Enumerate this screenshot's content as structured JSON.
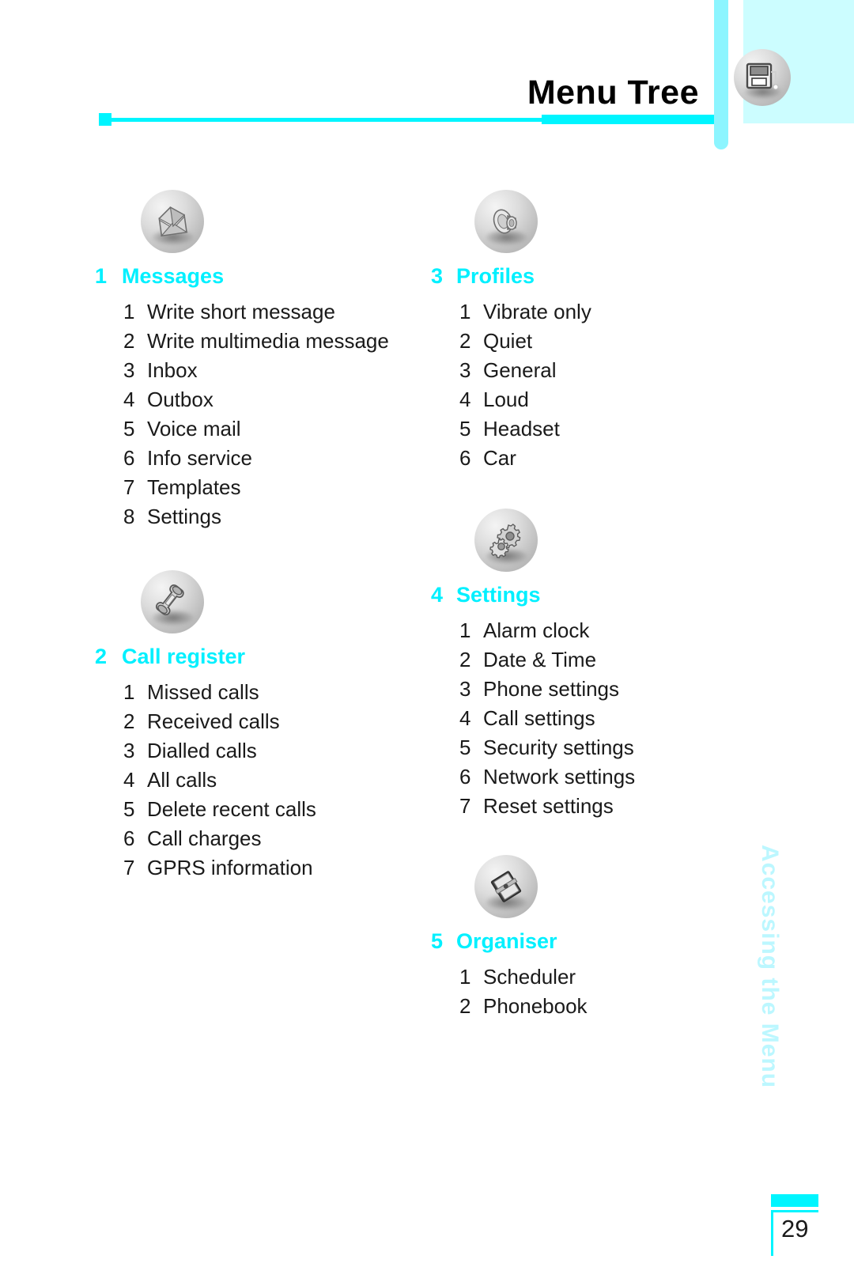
{
  "header": {
    "title": "Menu Tree",
    "icon": "floppy-disk-icon"
  },
  "side_tab": {
    "label": "Accessing the Menu"
  },
  "footer": {
    "page_number": "29"
  },
  "colors": {
    "accent_cyan": "#00f5ff",
    "heading_cyan": "#00f0ff",
    "panel_light_cyan": "#ccfdff",
    "side_tab_cyan": "#bcf7ff",
    "text_black": "#1a1a1a"
  },
  "columns": {
    "left": [
      {
        "number": "1",
        "title": "Messages",
        "icon": "envelope-icon",
        "items": [
          {
            "number": "1",
            "label": "Write short message"
          },
          {
            "number": "2",
            "label": "Write multimedia message"
          },
          {
            "number": "3",
            "label": "Inbox"
          },
          {
            "number": "4",
            "label": "Outbox"
          },
          {
            "number": "5",
            "label": "Voice mail"
          },
          {
            "number": "6",
            "label": "Info service"
          },
          {
            "number": "7",
            "label": "Templates"
          },
          {
            "number": "8",
            "label": "Settings"
          }
        ]
      },
      {
        "number": "2",
        "title": "Call register",
        "icon": "telephone-handset-icon",
        "items": [
          {
            "number": "1",
            "label": "Missed calls"
          },
          {
            "number": "2",
            "label": "Received calls"
          },
          {
            "number": "3",
            "label": "Dialled calls"
          },
          {
            "number": "4",
            "label": "All calls"
          },
          {
            "number": "5",
            "label": "Delete recent calls"
          },
          {
            "number": "6",
            "label": "Call charges"
          },
          {
            "number": "7",
            "label": "GPRS information"
          }
        ]
      }
    ],
    "right": [
      {
        "number": "3",
        "title": "Profiles",
        "icon": "speaker-icon",
        "items": [
          {
            "number": "1",
            "label": "Vibrate only"
          },
          {
            "number": "2",
            "label": "Quiet"
          },
          {
            "number": "3",
            "label": "General"
          },
          {
            "number": "4",
            "label": "Loud"
          },
          {
            "number": "5",
            "label": "Headset"
          },
          {
            "number": "6",
            "label": "Car"
          }
        ]
      },
      {
        "number": "4",
        "title": "Settings",
        "icon": "gears-icon",
        "items": [
          {
            "number": "1",
            "label": "Alarm clock"
          },
          {
            "number": "2",
            "label": "Date & Time"
          },
          {
            "number": "3",
            "label": "Phone settings"
          },
          {
            "number": "4",
            "label": "Call settings"
          },
          {
            "number": "5",
            "label": "Security settings"
          },
          {
            "number": "6",
            "label": "Network settings"
          },
          {
            "number": "7",
            "label": "Reset settings"
          }
        ]
      },
      {
        "number": "5",
        "title": "Organiser",
        "icon": "notebook-icon",
        "items": [
          {
            "number": "1",
            "label": "Scheduler"
          },
          {
            "number": "2",
            "label": "Phonebook"
          }
        ]
      }
    ]
  }
}
